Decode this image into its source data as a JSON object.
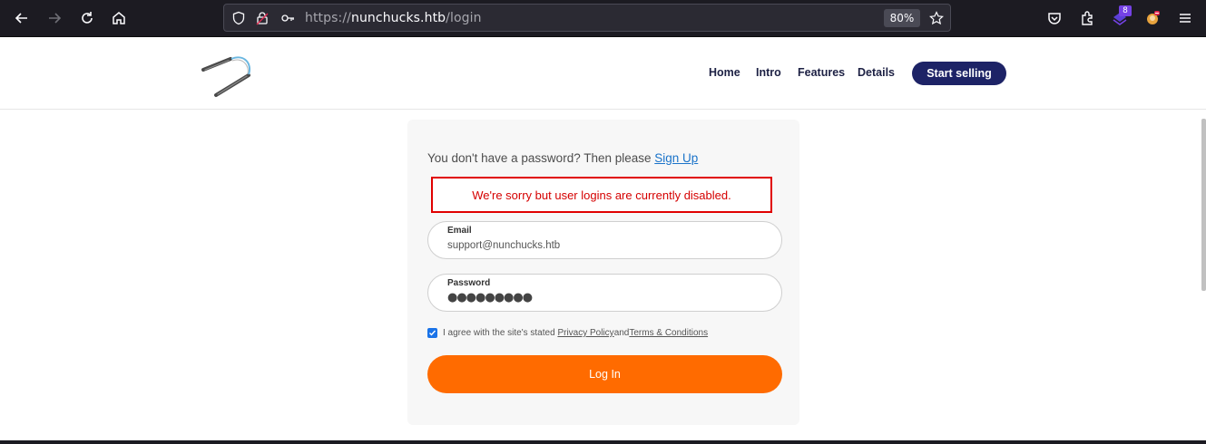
{
  "browser": {
    "url_scheme": "https://",
    "url_host": "nunchucks.htb",
    "url_path": "/login",
    "zoom": "80%",
    "extension_badge": "8",
    "icons": [
      "back-icon",
      "forward-icon",
      "reload-icon",
      "home-icon",
      "shield-icon",
      "lock-icon",
      "key-icon",
      "star-icon",
      "pocket-icon",
      "extensions-icon",
      "extension-badge-icon",
      "avatar-icon",
      "menu-icon"
    ]
  },
  "header": {
    "logo": "nunchucks-logo",
    "nav": [
      "Home",
      "Intro",
      "Features",
      "Details"
    ],
    "cta": "Start selling"
  },
  "login": {
    "signup_prefix": "You don't have a password? Then please ",
    "signup_link": "Sign Up",
    "error": "We're sorry but user logins are currently disabled.",
    "email_label": "Email",
    "email_value": "support@nunchucks.htb",
    "password_label": "Password",
    "password_mask": "●●●●●●●●●",
    "agree_prefix": "I agree with the site's stated ",
    "privacy_link": "Privacy Policy",
    "agree_mid": " and ",
    "terms_link": "Terms & Conditions",
    "agree_checked": true,
    "submit": "Log In"
  },
  "colors": {
    "accent_orange": "#ff6b00",
    "cta_navy": "#1d2366",
    "error_red": "#e00000",
    "link_blue": "#1a73c9"
  }
}
